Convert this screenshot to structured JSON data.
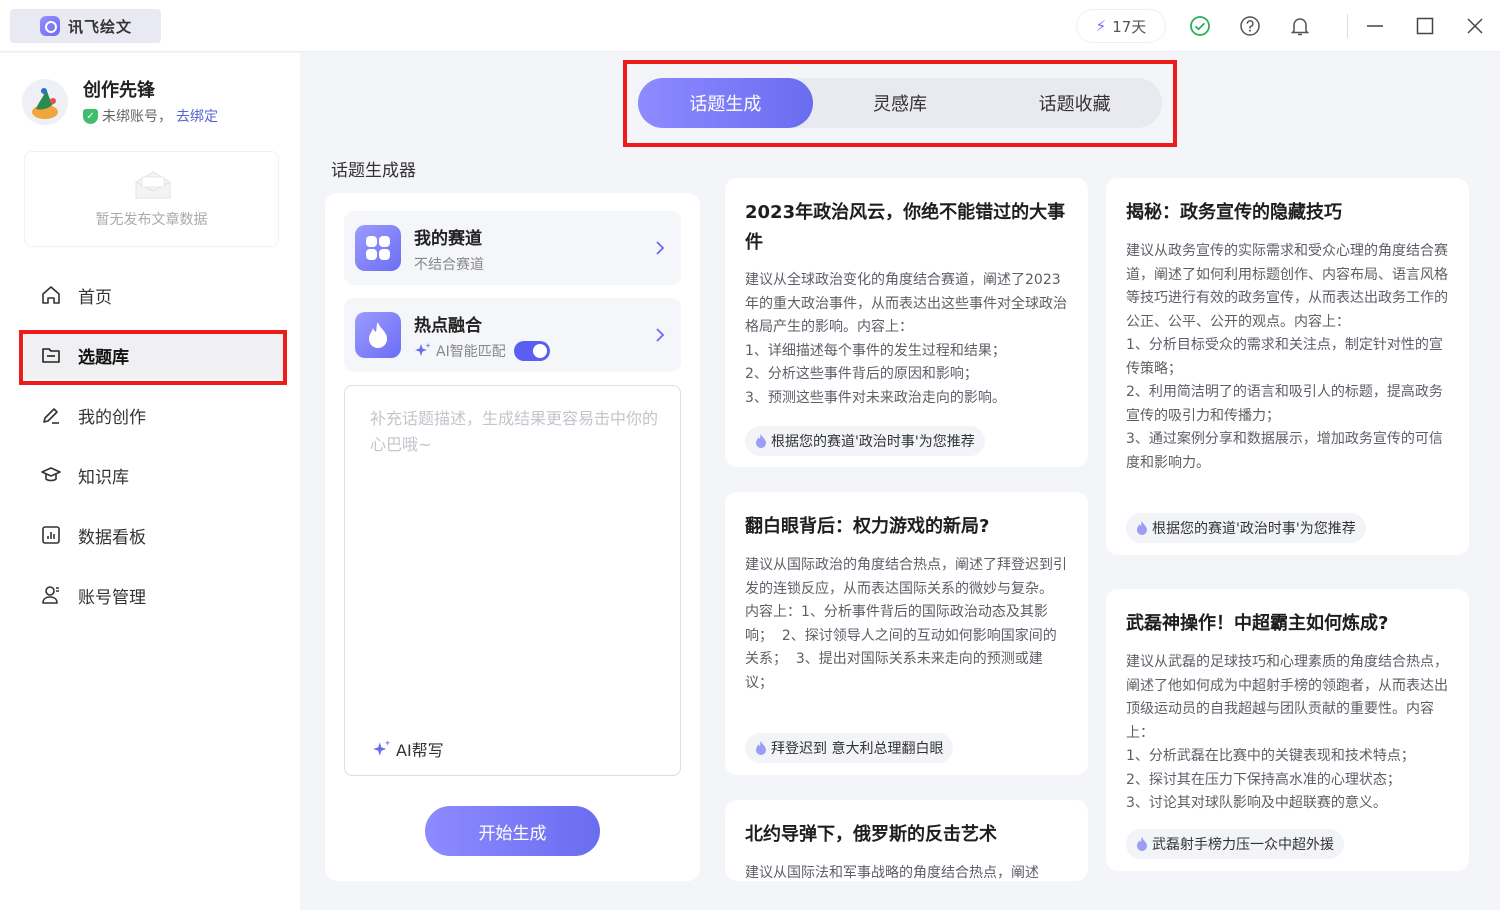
{
  "app": {
    "title": "讯飞绘文",
    "days": "17天"
  },
  "user": {
    "name": "创作先锋",
    "status": "未绑账号，",
    "bind_link": "去绑定"
  },
  "empty_text": "暂无发布文章数据",
  "nav": [
    {
      "label": "首页",
      "icon": "home-icon"
    },
    {
      "label": "选题库",
      "icon": "folder-icon"
    },
    {
      "label": "我的创作",
      "icon": "pen-icon"
    },
    {
      "label": "知识库",
      "icon": "graduation-cap-icon"
    },
    {
      "label": "数据看板",
      "icon": "chart-icon"
    },
    {
      "label": "账号管理",
      "icon": "user-settings-icon"
    }
  ],
  "tabs": [
    "话题生成",
    "灵感库",
    "话题收藏"
  ],
  "section_title": "话题生成器",
  "generator": {
    "track": {
      "title": "我的赛道",
      "subtitle": "不结合赛道"
    },
    "hot": {
      "title": "热点融合",
      "subtitle": "AI智能匹配",
      "toggle_on": true
    },
    "placeholder": "补充话题描述，生成结果更容易击中你的心巴哦~",
    "ai_help": "AI帮写",
    "start": "开始生成"
  },
  "cards": [
    {
      "title": "2023年政治风云，你绝不能错过的大事件",
      "body": "建议从全球政治变化的角度结合赛道，阐述了2023年的重大政治事件，从而表达出这些事件对全球政治格局产生的影响。内容上：\n1、详细描述每个事件的发生过程和结果；\n2、分析这些事件背后的原因和影响；\n3、预测这些事件对未来政治走向的影响。",
      "tag": "根据您的赛道'政治时事'为您推荐"
    },
    {
      "title": "翻白眼背后：权力游戏的新局?",
      "body": "建议从国际政治的角度结合热点，阐述了拜登迟到引发的连锁反应，从而表达国际关系的微妙与复杂。\n内容上：1、分析事件背后的国际政治动态及其影响；  2、探讨领导人之间的互动如何影响国家间的关系；  3、提出对国际关系未来走向的预测或建议；",
      "tag": "拜登迟到 意大利总理翻白眼"
    },
    {
      "title": "北约导弹下，俄罗斯的反击艺术",
      "body": "建议从国际法和军事战略的角度结合热点，阐述"
    },
    {
      "title": "揭秘：政务宣传的隐藏技巧",
      "body": "建议从政务宣传的实际需求和受众心理的角度结合赛道，阐述了如何利用标题创作、内容布局、语言风格等技巧进行有效的政务宣传，从而表达出政务工作的公正、公平、公开的观点。内容上：\n1、分析目标受众的需求和关注点，制定针对性的宣传策略；\n2、利用简洁明了的语言和吸引人的标题，提高政务宣传的吸引力和传播力；\n3、通过案例分享和数据展示，增加政务宣传的可信度和影响力。",
      "tag": "根据您的赛道'政治时事'为您推荐"
    },
    {
      "title": "武磊神操作！中超霸主如何炼成?",
      "body": "建议从武磊的足球技巧和心理素质的角度结合热点，阐述了他如何成为中超射手榜的领跑者，从而表达出顶级运动员的自我超越与团队贡献的重要性。内容上：\n1、分析武磊在比赛中的关键表现和技术特点；\n2、探讨其在压力下保持高水准的心理状态；\n3、讨论其对球队影响及中超联赛的意义。",
      "tag": "武磊射手榜力压一众中超外援"
    }
  ],
  "colors": {
    "accent": "#6a6cf0",
    "highlight": "#ee1b1b"
  }
}
